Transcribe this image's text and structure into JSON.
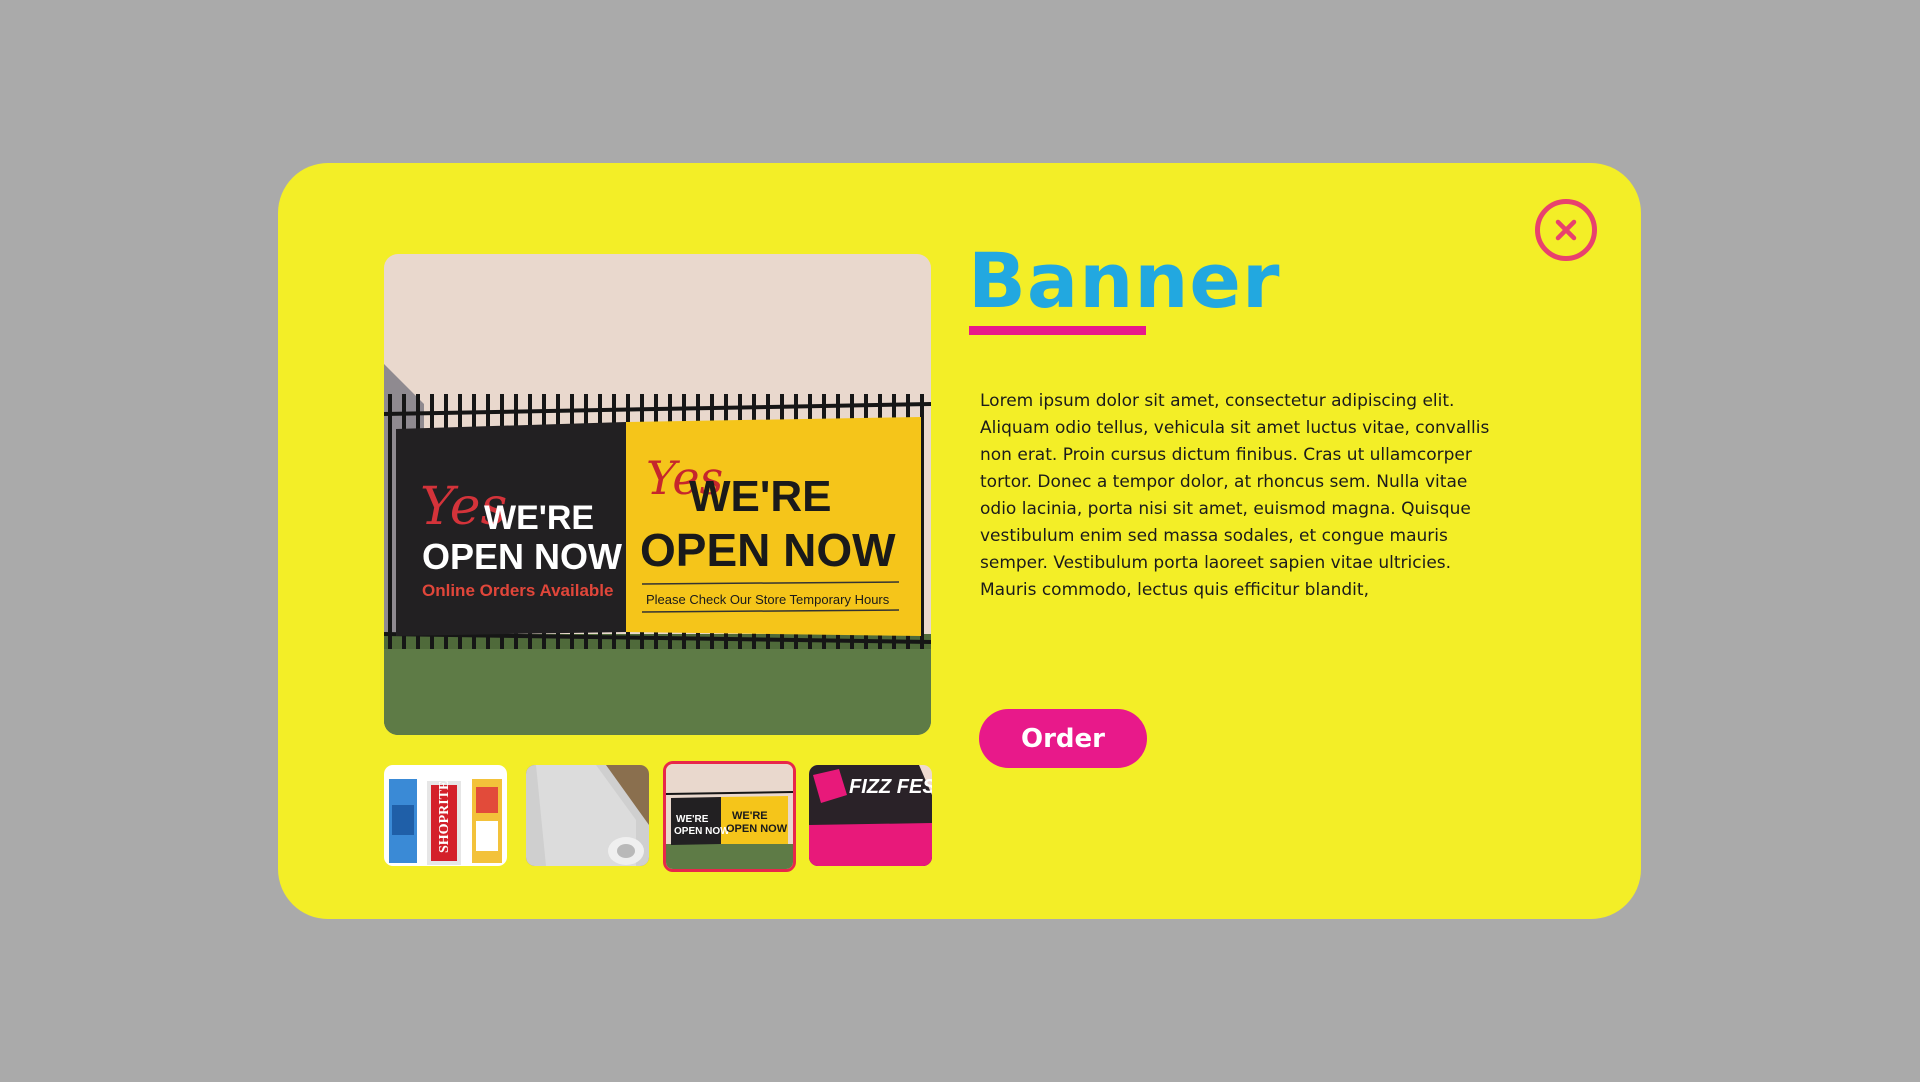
{
  "product": {
    "title": "Banner",
    "description": "Lorem ipsum dolor sit amet, consectetur adipiscing elit. Aliquam odio tellus, vehicula sit amet luctus vitae, convallis non erat. Proin cursus dictum finibus. Cras ut ullamcorper tortor. Donec a tempor dolor, at rhoncus sem. Nulla vitae odio lacinia, porta nisi sit amet, euismod magna. Quisque vestibulum enim sed massa sodales, et congue mauris semper. Vestibulum porta laoreet sapien vitae ultricies. Mauris commodo, lectus quis efficitur blandit,",
    "order_label": "Order"
  },
  "main_image": {
    "left_panel": {
      "script": "Yes",
      "line1": "WE'RE",
      "line2": "OPEN NOW",
      "line3": "Online Orders Available"
    },
    "right_panel": {
      "script": "Yes",
      "line1": "WE'RE",
      "line2": "OPEN NOW",
      "line3": "Please Check Our Store Temporary  Hours"
    }
  },
  "thumbnails": [
    {
      "name": "roll-up banners",
      "text": "SHOPRITE"
    },
    {
      "name": "vinyl roll"
    },
    {
      "name": "fence banner",
      "selected": true
    },
    {
      "name": "fizzfest banner",
      "text": "FIZZ FEST"
    }
  ],
  "colors": {
    "backdrop": "#aaaaaa",
    "modal": "#f3ee27",
    "title": "#22a8e0",
    "accent": "#e8198a",
    "close": "#e8416e"
  },
  "icons": {
    "close": "close-circle-icon"
  }
}
